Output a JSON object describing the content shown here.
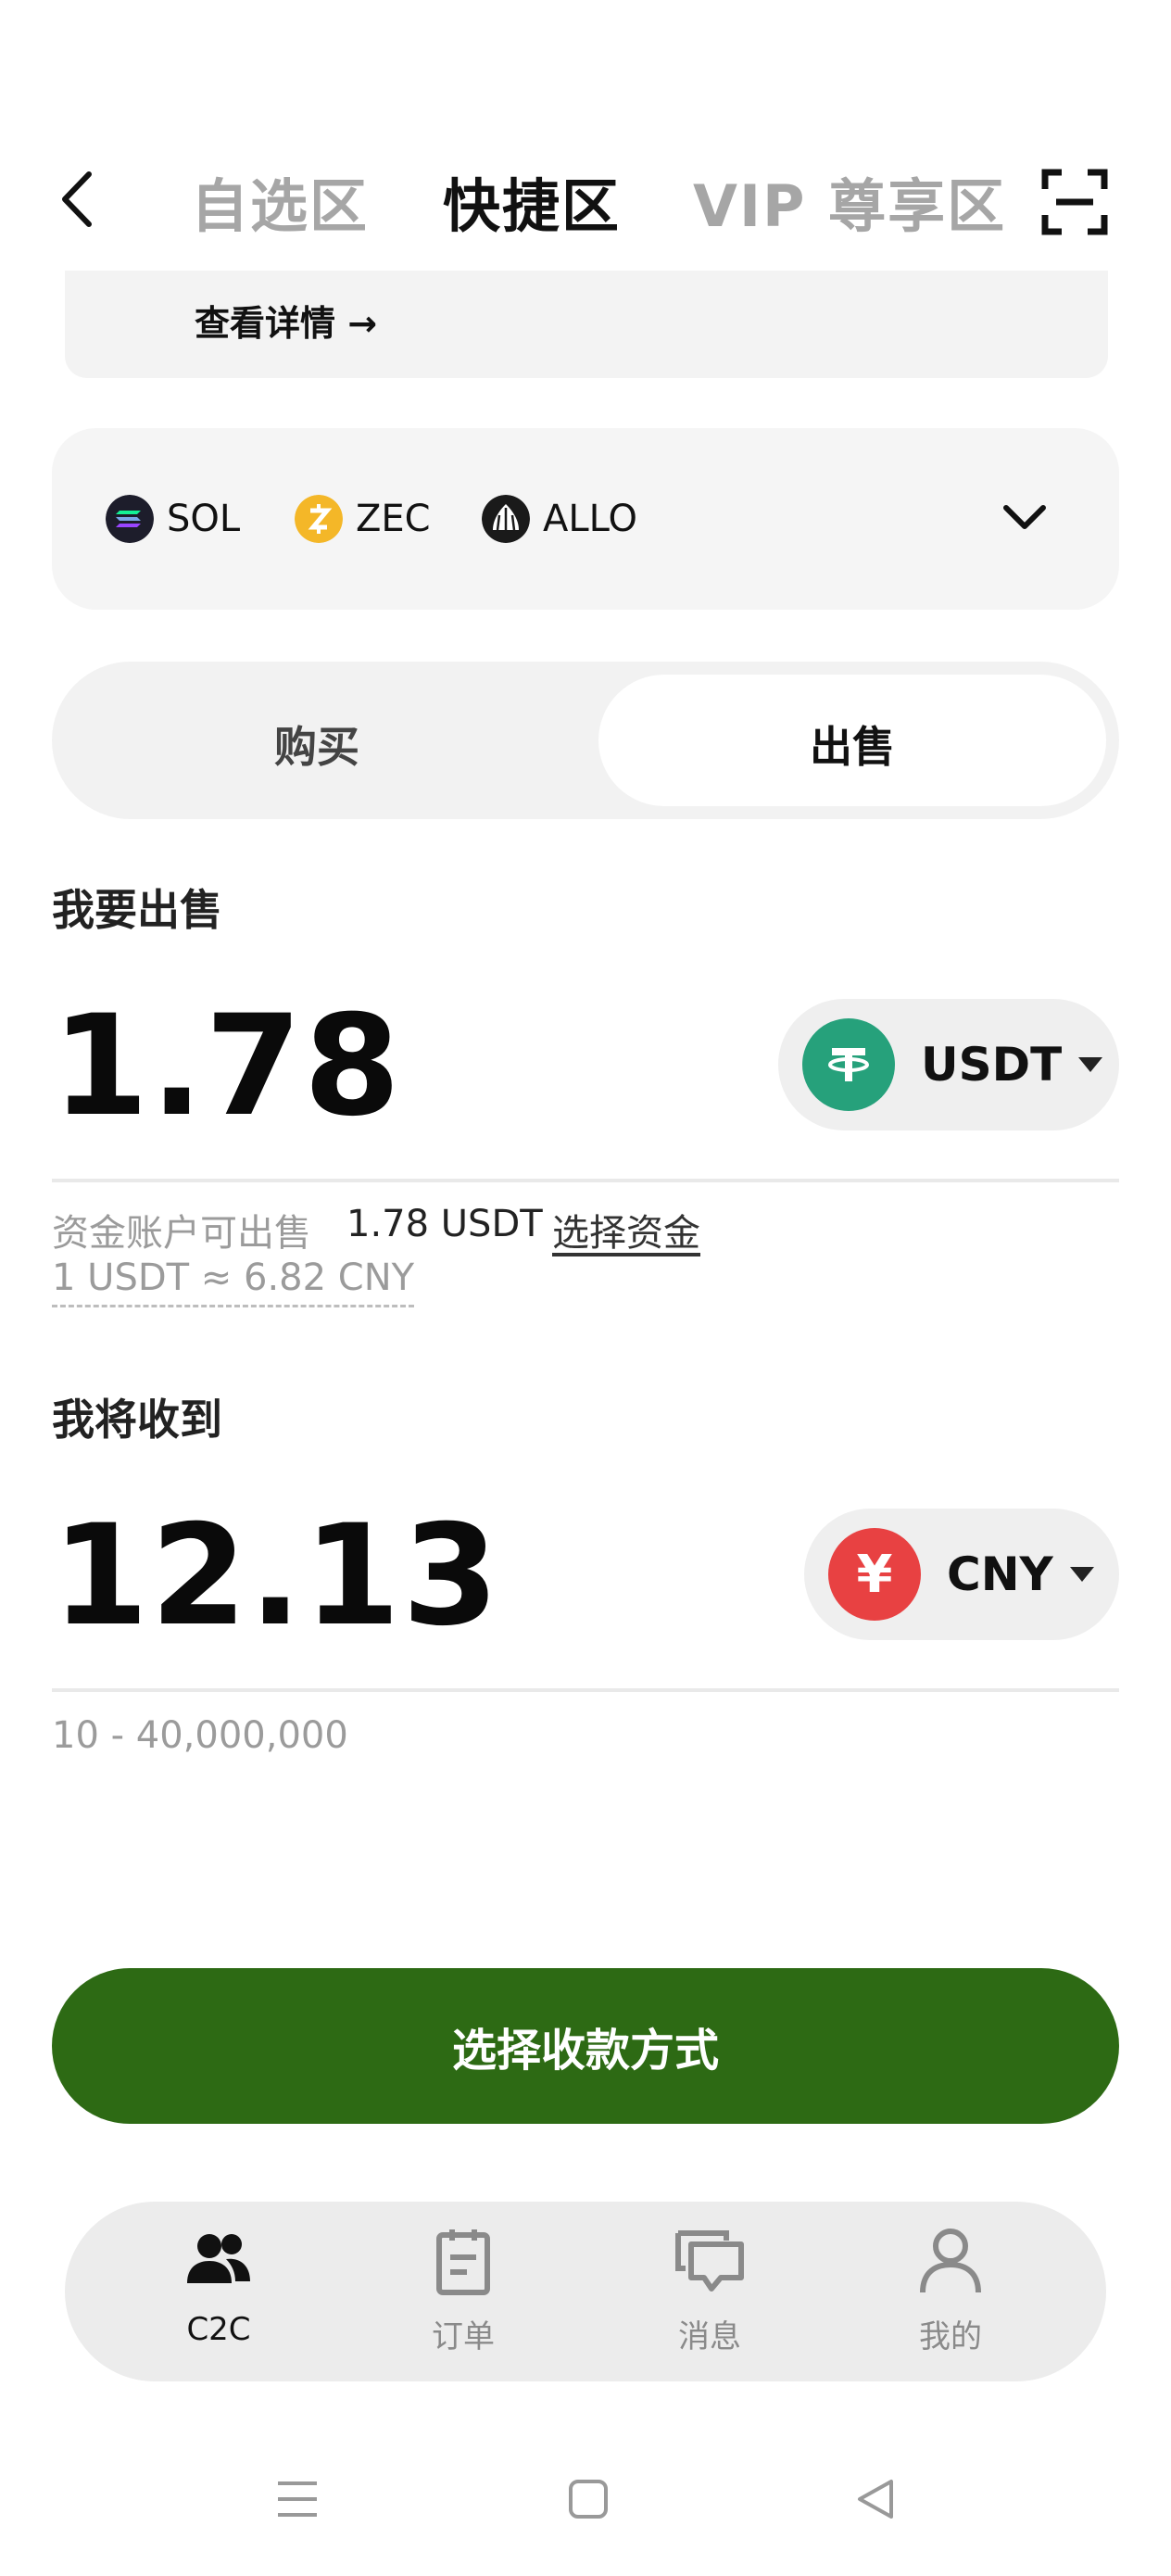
{
  "header": {
    "tabs": [
      {
        "label": "自选区",
        "active": false
      },
      {
        "label": "快捷区",
        "active": true
      },
      {
        "label": "VIP 尊享区",
        "active": false
      }
    ]
  },
  "banner": {
    "link_label": "查看详情 →"
  },
  "coins": [
    {
      "symbol": "SOL",
      "icon": "sol-icon"
    },
    {
      "symbol": "ZEC",
      "icon": "zec-icon"
    },
    {
      "symbol": "ALLO",
      "icon": "allo-icon"
    }
  ],
  "trade_toggle": {
    "buy": "购买",
    "sell": "出售",
    "selected": "sell"
  },
  "sell_section": {
    "title": "我要出售",
    "amount": "1.78",
    "currency": "USDT",
    "available_label": "资金账户可出售",
    "available_value": "1.78 USDT",
    "select_funds": "选择资金",
    "rate": "1 USDT ≈ 6.82 CNY"
  },
  "receive_section": {
    "title": "我将收到",
    "amount": "12.13",
    "currency": "CNY",
    "currency_symbol": "¥",
    "range": "10 - 40,000,000"
  },
  "cta": {
    "label": "选择收款方式"
  },
  "bottom_nav": [
    {
      "label": "C2C",
      "icon": "users-icon",
      "active": true
    },
    {
      "label": "订单",
      "icon": "clipboard-icon",
      "active": false
    },
    {
      "label": "消息",
      "icon": "chat-icon",
      "active": false
    },
    {
      "label": "我的",
      "icon": "profile-icon",
      "active": false
    }
  ],
  "colors": {
    "primary_green": "#2d6a14",
    "usdt_teal": "#26a17b",
    "cny_red": "#e84142",
    "zec_yellow": "#f4b728"
  }
}
